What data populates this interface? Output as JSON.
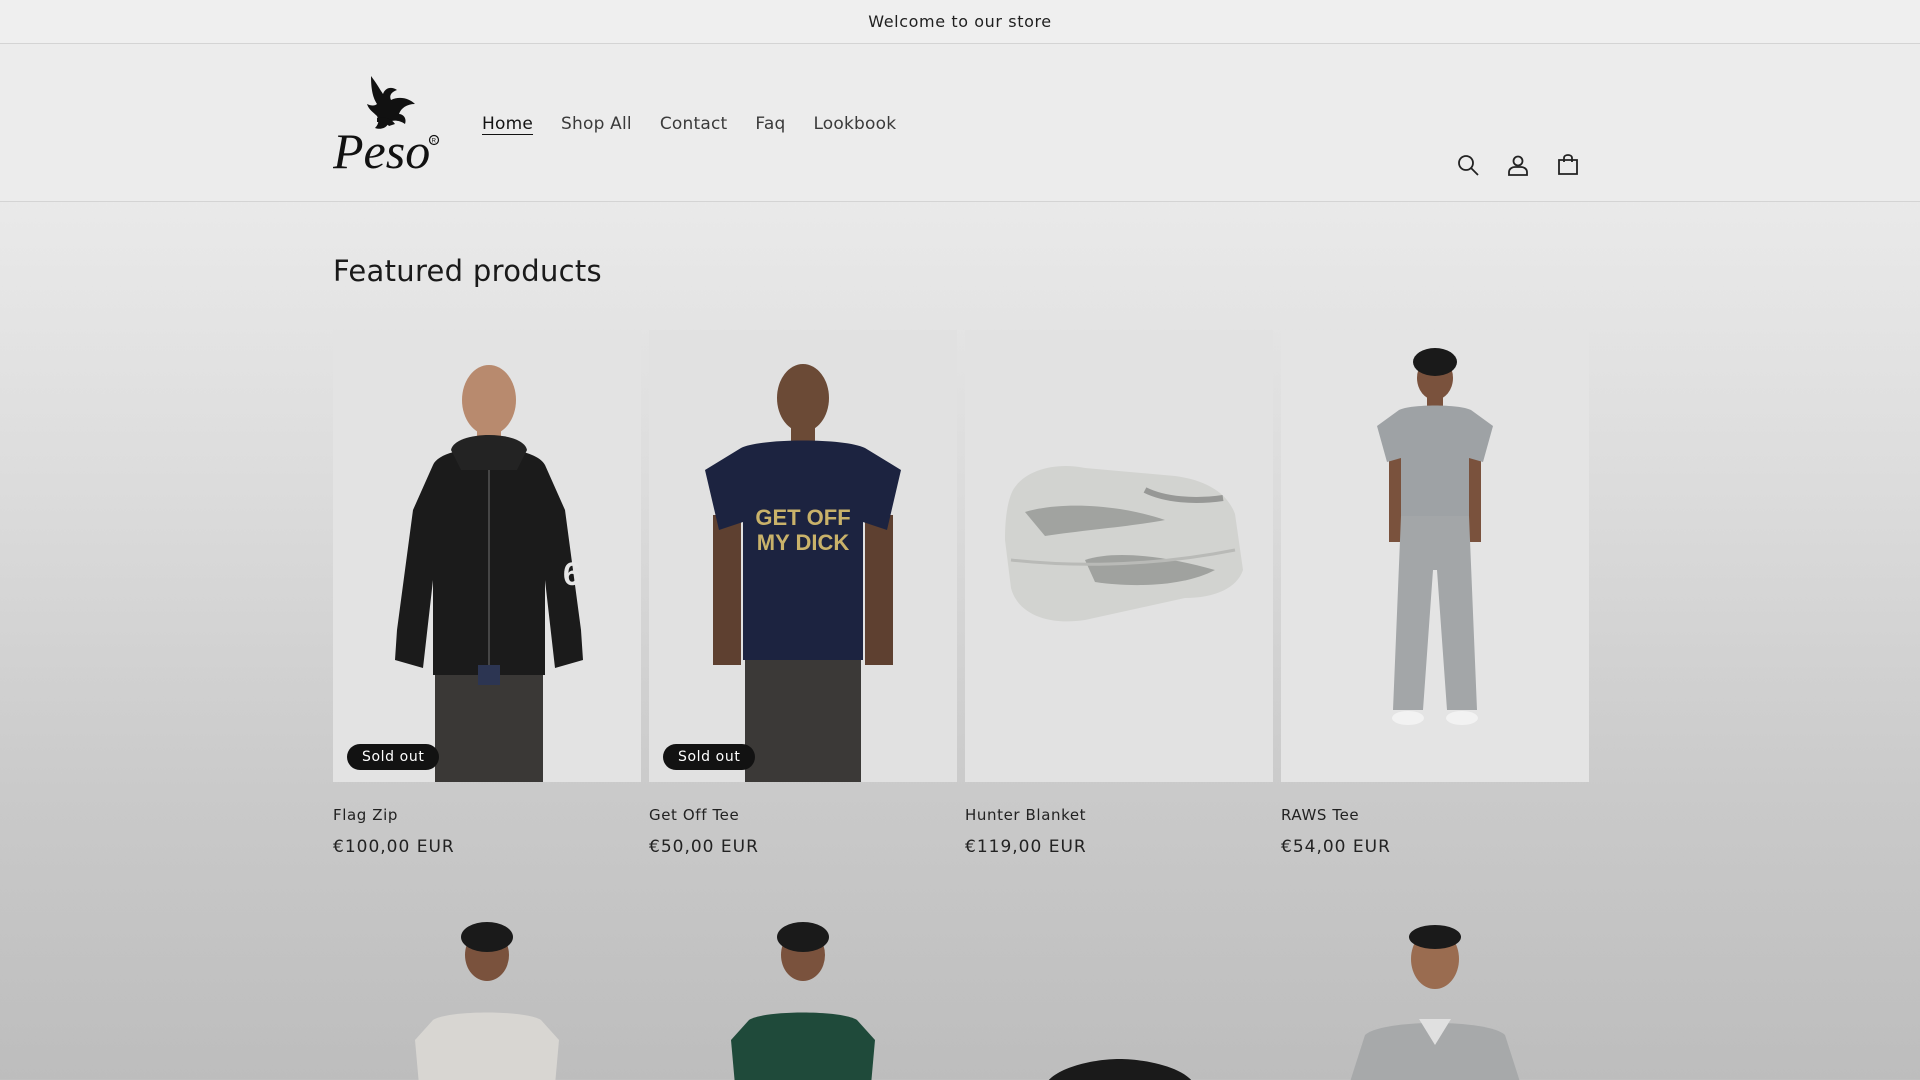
{
  "announcement": {
    "text": "Welcome to our store"
  },
  "header": {
    "logo_text": "Peso",
    "nav": [
      {
        "label": "Home",
        "active": true
      },
      {
        "label": "Shop All",
        "active": false
      },
      {
        "label": "Contact",
        "active": false
      },
      {
        "label": "Faq",
        "active": false
      },
      {
        "label": "Lookbook",
        "active": false
      }
    ],
    "icons": [
      "search-icon",
      "account-icon",
      "cart-icon"
    ]
  },
  "featured": {
    "title": "Featured products",
    "products": [
      {
        "name": "Flag Zip",
        "price": "€100,00 EUR",
        "badge": "Sold out"
      },
      {
        "name": "Get Off Tee",
        "price": "€50,00 EUR",
        "badge": "Sold out",
        "graphic_text": [
          "GET OFF",
          "MY DICK"
        ]
      },
      {
        "name": "Hunter Blanket",
        "price": "€119,00 EUR",
        "badge": ""
      },
      {
        "name": "RAWS Tee",
        "price": "€54,00 EUR",
        "badge": ""
      }
    ]
  },
  "colors": {
    "accent": "#121212",
    "badge_bg": "#121212",
    "badge_text": "#ffffff",
    "tee_navy": "#1c2340",
    "tee_green": "#1f4a3a",
    "grey_set": "#9ea2a5"
  }
}
